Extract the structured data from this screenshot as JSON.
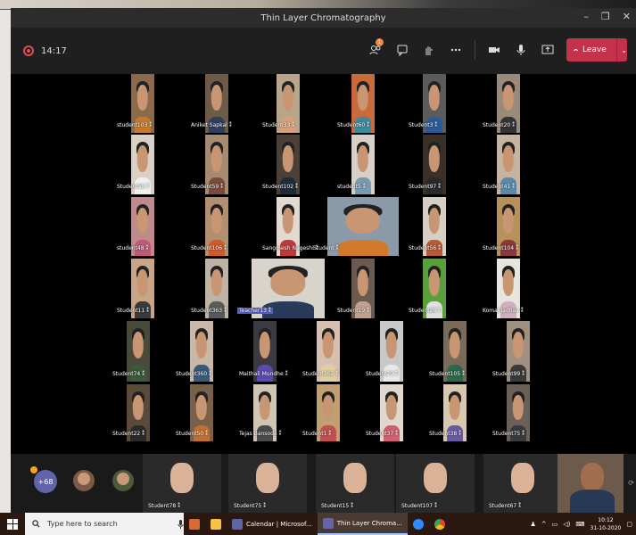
{
  "window": {
    "title": "Thin Layer Chromatography",
    "minimize_glyph": "–",
    "maximize_glyph": "❐",
    "close_glyph": "✕"
  },
  "toolbar": {
    "recording_time": "14:17",
    "participants_badge": "1",
    "leave_label": "Leave",
    "icons": [
      "participants-icon",
      "chat-icon",
      "raise-hand-icon",
      "more-options-icon",
      "camera-icon",
      "microphone-icon",
      "share-screen-icon"
    ]
  },
  "grid": [
    {
      "name": "student103",
      "bg": "#8a6a4a",
      "shirt": "#c77a2a"
    },
    {
      "name": "Aniket Sapkal",
      "bg": "#6e5a48",
      "shirt": "#2e3f5c"
    },
    {
      "name": "Student33",
      "bg": "#b9a58c",
      "shirt": "#d8a07a"
    },
    {
      "name": "Student60",
      "bg": "#c96a3a",
      "shirt": "#3a8aa0"
    },
    {
      "name": "Student3",
      "bg": "#5b5b5b",
      "shirt": "#2a5a9a"
    },
    {
      "name": "Student20",
      "bg": "#9a8a7a",
      "shirt": "#333333"
    },
    {
      "name": "Student58",
      "bg": "#d8d0c4",
      "shirt": "#f0f0f0"
    },
    {
      "name": "Student59",
      "bg": "#a58c70",
      "shirt": "#7a4a3a"
    },
    {
      "name": "Student102",
      "bg": "#4a4038",
      "shirt": "#1f2b3a"
    },
    {
      "name": "student5",
      "bg": "#d6d0c8",
      "shirt": "#7a9ab0"
    },
    {
      "name": "Student97",
      "bg": "#3a3028",
      "shirt": "#2a2a2a"
    },
    {
      "name": "Student41",
      "bg": "#c4b4a0",
      "shirt": "#5a8aa8"
    },
    {
      "name": "student48",
      "bg": "#c08a8a",
      "shirt": "#c05a7a"
    },
    {
      "name": "Student106",
      "bg": "#b09070",
      "shirt": "#d05a2a"
    },
    {
      "name": "Sangmesh Nageshi",
      "bg": "#e2dad0",
      "shirt": "#c03a3a"
    },
    {
      "name": "Student",
      "bg": "#8a9aa8",
      "shirt": "#d07a2a"
    },
    {
      "name": "Student56",
      "bg": "#d8cfc4",
      "shirt": "#b85a3a"
    },
    {
      "name": "Student104",
      "bg": "#b8905a",
      "shirt": "#8a3a3a"
    },
    {
      "name": "Student11",
      "bg": "#c8a488",
      "shirt": "#3a3a3a"
    },
    {
      "name": "Student363",
      "bg": "#bfb3a6",
      "shirt": "#5a5a5a"
    },
    {
      "name": "Teacher13",
      "bg": "#d8d4cc",
      "shirt": "#2a3a5a"
    },
    {
      "name": "Student19",
      "bg": "#6a5a50",
      "shirt": "#c0a090"
    },
    {
      "name": "Student28",
      "bg": "#5aa03a",
      "shirt": "#e0e0e0"
    },
    {
      "name": "Komal Jadhav",
      "bg": "#e8e4de",
      "shirt": "#d0b0c0"
    },
    {
      "name": "Student74",
      "bg": "#4a4a3a",
      "shirt": "#3a5a3a"
    },
    {
      "name": "Student360",
      "bg": "#c8b8a8",
      "shirt": "#3a5a7a"
    },
    {
      "name": "Maithali Mundhe",
      "bg": "#3a3a40",
      "shirt": "#5a4ab0"
    },
    {
      "name": "Student362",
      "bg": "#d8c0b0",
      "shirt": "#e0d0a0"
    },
    {
      "name": "Student79",
      "bg": "#c8c8c8",
      "shirt": "#e8e8e8"
    },
    {
      "name": "Student105",
      "bg": "#7a6a5a",
      "shirt": "#2a6a4a"
    },
    {
      "name": "Student99",
      "bg": "#a09080",
      "shirt": "#3a3a3a"
    },
    {
      "name": "Student22",
      "bg": "#5a4a3a",
      "shirt": "#2a2a2a"
    },
    {
      "name": "Student50",
      "bg": "#7a6048",
      "shirt": "#c07030"
    },
    {
      "name": "Tejas Bansode",
      "bg": "#d0c4b4",
      "shirt": "#4a4a4a"
    },
    {
      "name": "Student1",
      "bg": "#c0a070",
      "shirt": "#c05050"
    },
    {
      "name": "Student37",
      "bg": "#e0d8cc",
      "shirt": "#d06070"
    },
    {
      "name": "Student38",
      "bg": "#d8c8b0",
      "shirt": "#6a5aa0"
    },
    {
      "name": "Student75",
      "bg": "#6a6058",
      "shirt": "#3a3a3a"
    }
  ],
  "strip": {
    "overflow_count": "+68",
    "tiles": [
      {
        "name": "Student78"
      },
      {
        "name": "Student75"
      },
      {
        "name": "Student15"
      },
      {
        "name": "Student107"
      },
      {
        "name": "Student67"
      }
    ]
  },
  "taskbar": {
    "search_placeholder": "Type here to search",
    "apps": [
      {
        "label": "Calendar | Microsof...",
        "color": "#6264a7"
      },
      {
        "label": "Thin Layer Chroma...",
        "color": "#6264a7"
      }
    ],
    "time": "10:12",
    "date": "31-10-2020"
  }
}
